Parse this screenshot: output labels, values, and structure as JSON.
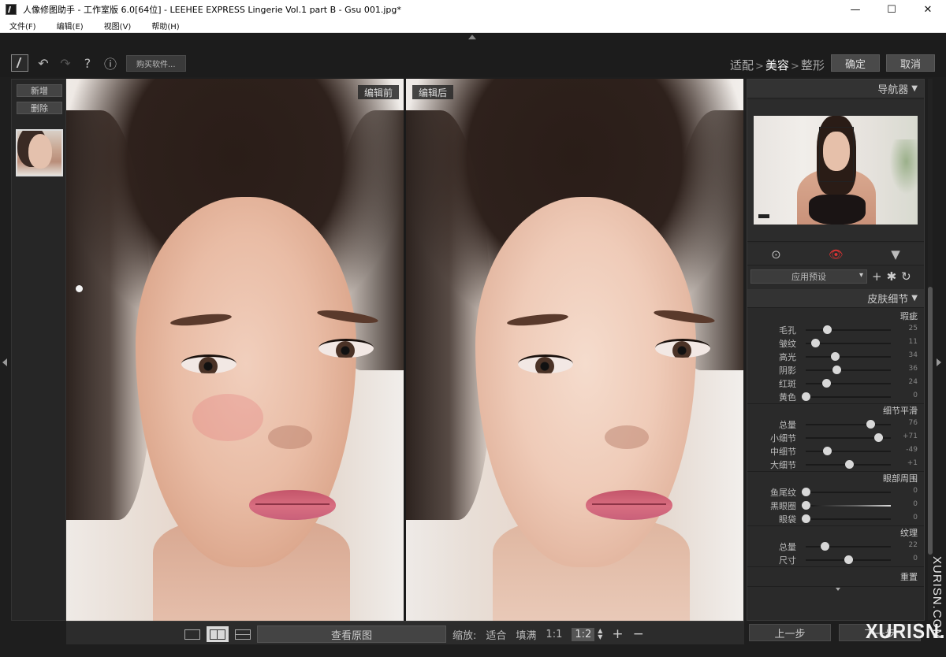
{
  "window": {
    "title": "人像修图助手 - 工作室版 6.0[64位] - LEEHEE EXPRESS Lingerie  Vol.1 part B - Gsu 001.jpg*",
    "controls": {
      "minimize": "—",
      "maximize": "☐",
      "close": "✕"
    }
  },
  "menu": [
    "文件(F)",
    "编辑(E)",
    "视图(V)",
    "帮助(H)"
  ],
  "toolbar": {
    "buy_label": "购买软件...",
    "icons": [
      "undo-icon",
      "redo-icon",
      "help-icon",
      "info-icon"
    ],
    "undo": "↶",
    "redo": "↷",
    "help": "?",
    "info": "ⓘ"
  },
  "steps": {
    "items": [
      "适配",
      "美容",
      "整形"
    ],
    "separator": ">",
    "active": "美容"
  },
  "actions": {
    "ok": "确定",
    "cancel": "取消"
  },
  "left_panel": {
    "add": "新增",
    "delete": "删除"
  },
  "photos": {
    "before_label": "编辑前",
    "after_label": "编辑后"
  },
  "bottom_bar": {
    "view_original": "查看原图",
    "zoom_label": "缩放:",
    "fit": "适合",
    "fill": "填满",
    "ratio_1_1": "1:1",
    "ratio_1_2": "1:2",
    "plus": "+",
    "minus": "−",
    "spin_up": "▲",
    "spin_down": "▼"
  },
  "right_panel": {
    "navigator": "导航器",
    "preset_label": "应用预设",
    "preset_icons": {
      "add": "+",
      "settings": "✱",
      "refresh": "↻"
    },
    "tool_icons": {
      "brush": "⊙",
      "eye": "👁",
      "mask": "▼"
    },
    "skin_detail": "皮肤细节",
    "sections": [
      {
        "title": "瑕疵",
        "sliders": [
          {
            "label": "毛孔",
            "value": 25
          },
          {
            "label": "皱纹",
            "value": 11
          },
          {
            "label": "高光",
            "value": 34
          },
          {
            "label": "阴影",
            "value": 36
          },
          {
            "label": "红斑",
            "value": 24
          },
          {
            "label": "黄色",
            "value": 0
          }
        ]
      },
      {
        "title": "细节平滑",
        "sliders": [
          {
            "label": "总量",
            "value": "76"
          },
          {
            "label": "小细节",
            "value": "+71"
          },
          {
            "label": "中细节",
            "value": "-49"
          },
          {
            "label": "大细节",
            "value": "+1"
          }
        ]
      },
      {
        "title": "眼部周围",
        "sliders": [
          {
            "label": "鱼尾纹",
            "value": "0"
          },
          {
            "label": "黑眼圈",
            "value": "0"
          },
          {
            "label": "眼袋",
            "value": "0"
          }
        ]
      },
      {
        "title": "纹理",
        "sliders": [
          {
            "label": "总量",
            "value": "22"
          },
          {
            "label": "尺寸",
            "value": "0"
          }
        ]
      }
    ],
    "reset": "重置",
    "slider_levels": [
      0.25,
      0.11,
      0.34,
      0.36,
      0.24,
      0.0,
      0.76,
      0.85,
      0.25,
      0.51,
      0.0,
      0.0,
      0.0,
      0.22,
      0.5
    ]
  },
  "nav": {
    "prev": "上一步",
    "next": "下一步"
  },
  "watermark": {
    "text": "XURISN.COM",
    "vertical": "XURISN.COM"
  }
}
